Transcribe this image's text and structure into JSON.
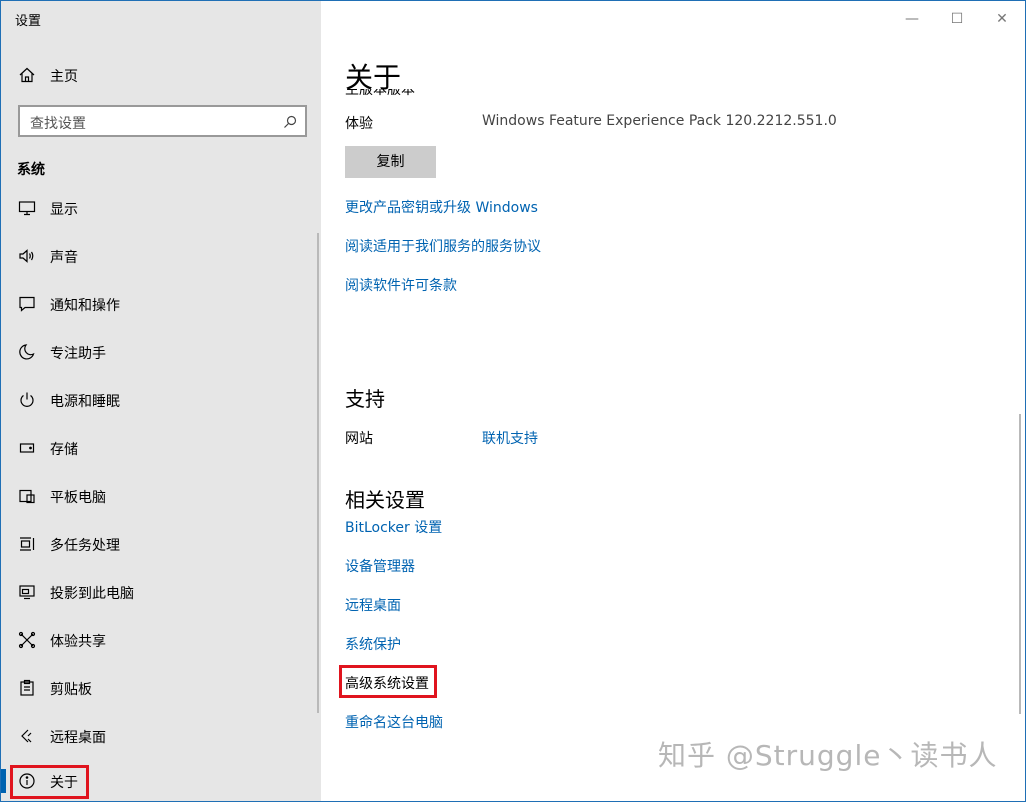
{
  "window": {
    "title": "设置",
    "buttons": {
      "minimize": "—",
      "maximize": "☐",
      "close": "✕"
    }
  },
  "sidebar": {
    "home_label": "主页",
    "search_placeholder": "查找设置",
    "section_title": "系统",
    "items": [
      {
        "label": "显示",
        "icon": "monitor-icon"
      },
      {
        "label": "声音",
        "icon": "speaker-icon"
      },
      {
        "label": "通知和操作",
        "icon": "message-icon"
      },
      {
        "label": "专注助手",
        "icon": "moon-icon"
      },
      {
        "label": "电源和睡眠",
        "icon": "power-icon"
      },
      {
        "label": "存储",
        "icon": "storage-icon"
      },
      {
        "label": "平板电脑",
        "icon": "tablet-icon"
      },
      {
        "label": "多任务处理",
        "icon": "multitask-icon"
      },
      {
        "label": "投影到此电脑",
        "icon": "project-icon"
      },
      {
        "label": "体验共享",
        "icon": "share-icon"
      },
      {
        "label": "剪贴板",
        "icon": "clipboard-icon"
      },
      {
        "label": "远程桌面",
        "icon": "remote-icon"
      },
      {
        "label": "关于",
        "icon": "info-icon",
        "selected": true
      }
    ]
  },
  "main": {
    "title": "关于",
    "cut_text": "主版本版本",
    "experience_label": "体验",
    "experience_value": "Windows Feature Experience Pack 120.2212.551.0",
    "copy_button": "复制",
    "links": [
      "更改产品密钥或升级 Windows",
      "阅读适用于我们服务的服务协议",
      "阅读软件许可条款"
    ],
    "support": {
      "title": "支持",
      "website_label": "网站",
      "website_link": "联机支持"
    },
    "related": {
      "title": "相关设置",
      "links": [
        "BitLocker 设置",
        "设备管理器",
        "远程桌面",
        "系统保护",
        "高级系统设置",
        "重命名这台电脑"
      ]
    }
  },
  "watermark": "知乎 @Struggle丶读书人",
  "colors": {
    "accent": "#0063b1",
    "highlight": "#e0141e",
    "sidebar_bg": "#e6e6e6"
  }
}
